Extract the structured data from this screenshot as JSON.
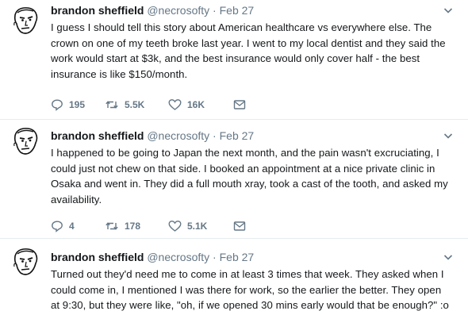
{
  "tweets": [
    {
      "name": "brandon sheffield",
      "handle": "@necrosofty",
      "separator": "·",
      "date": "Feb 27",
      "text": "I guess I should tell this story about American healthcare vs everywhere else. The crown on one of my teeth broke last year. I went to my local dentist and they said the work would start at $3k, and the best insurance would only cover half - the best insurance is like $150/month.",
      "replies": "195",
      "retweets": "5.5K",
      "likes": "16K"
    },
    {
      "name": "brandon sheffield",
      "handle": "@necrosofty",
      "separator": "·",
      "date": "Feb 27",
      "text": "I happened to be going to Japan the next month, and the pain wasn't excruciating, I could just not chew on that side. I booked an appointment at a nice private clinic in Osaka and went in. They did a full mouth xray, took a cast of the tooth, and asked my availability.",
      "replies": "4",
      "retweets": "178",
      "likes": "5.1K"
    },
    {
      "name": "brandon sheffield",
      "handle": "@necrosofty",
      "separator": "·",
      "date": "Feb 27",
      "text": "Turned out they'd need me to come in at least 3 times that week. They asked when I could come in, I mentioned I was there for work, so the earlier the better. They open at 9:30, but they were like, \"oh, if we opened 30 mins early would that be enough?\" :o"
    }
  ]
}
